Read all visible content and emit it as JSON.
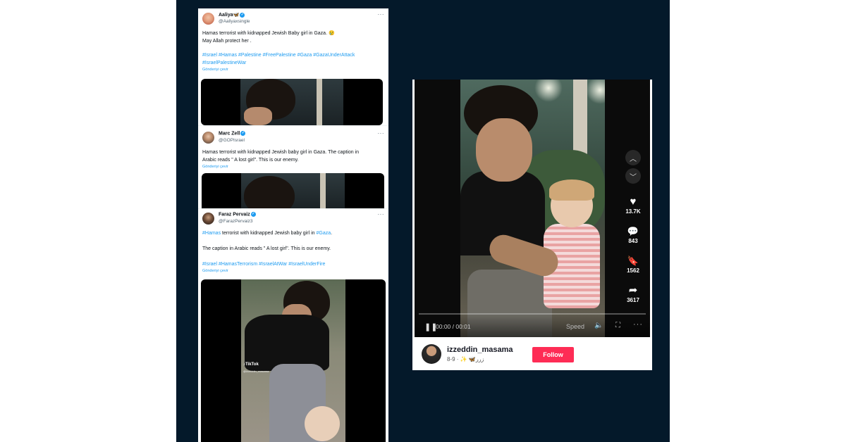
{
  "tweets": [
    {
      "name": "Aaliya🦋",
      "handle": "@Aaliyaxsingle",
      "text_lines": [
        "Hamas terrorist with kidnapped Jewish Baby girl in Gaza. 😢",
        "May Allah protect her ."
      ],
      "hashtag_lines": [
        "#Israel #Hamas #Palestine #FreePalestine #Gaza #GazaUnderAttack",
        "#IsraelPalestineWar"
      ],
      "translate": "Gönderiyi çevir"
    },
    {
      "name": "Marc Zell",
      "handle": "@GOPIsrael",
      "text_lines": [
        "Hamas terrorist with kidnapped Jewish baby girl in Gaza.  The caption in",
        "Arabic reads \" A lost girl\".  This is our enemy."
      ],
      "translate": "Gönderiyi çevir"
    },
    {
      "name": "Faraz Pervaiz",
      "handle": "@FarazPervaiz3",
      "text_parts": [
        "#Hamas",
        " terrorist with kidnapped Jewish baby girl in ",
        "#Gaza",
        "."
      ],
      "text_line2": "The caption in Arabic reads \" A lost girl\".  This is our enemy.",
      "hashtag_line": "#Israel #HamasTerrorism #IsraelAtWar #IsraelUnderFire",
      "translate": "Gönderiyi çevir",
      "watermark": "TikTok",
      "watermark_handle": "@izzeddin_masama"
    }
  ],
  "more_glyph": "···",
  "tiktok": {
    "likes": "13.7K",
    "comments": "843",
    "saves": "1562",
    "shares": "3617",
    "time": "00:00 / 00:01",
    "speed": "Speed",
    "username": "izzeddin_masama",
    "subtitle": "زرر🦋 ✨ · 9-8",
    "follow": "Follow",
    "progress": 0
  },
  "colors": {
    "background": "#04192a",
    "link": "#1d9bf0",
    "follow": "#fe2c55"
  }
}
